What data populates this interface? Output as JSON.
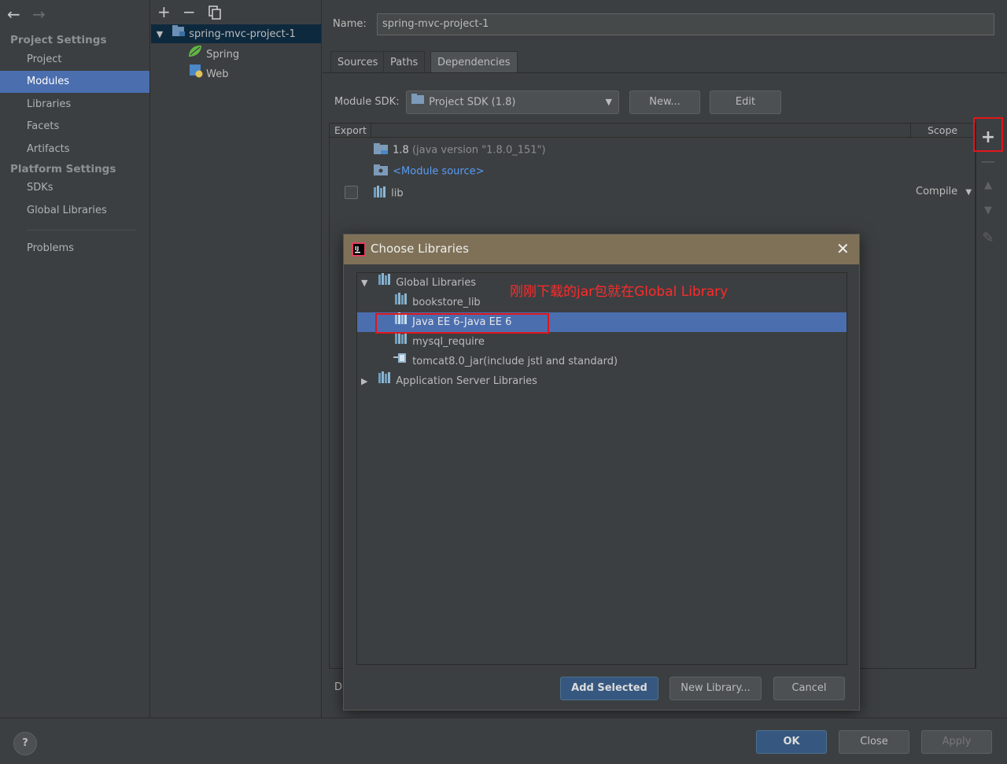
{
  "nav": {
    "back_icon": "arrow-left-icon",
    "forward_icon": "arrow-right-icon",
    "project_settings_heading": "Project Settings",
    "project_settings_items": [
      "Project",
      "Modules",
      "Libraries",
      "Facets",
      "Artifacts"
    ],
    "platform_settings_heading": "Platform Settings",
    "platform_settings_items": [
      "SDKs",
      "Global Libraries"
    ],
    "problems": "Problems",
    "selected_item": "Modules"
  },
  "module_tree": {
    "toolbar": {
      "add": "+",
      "remove": "−",
      "copy": "copy-icon"
    },
    "root": "spring-mvc-project-1",
    "children": [
      "Spring",
      "Web"
    ]
  },
  "module": {
    "name_label": "Name:",
    "name_value": "spring-mvc-project-1",
    "tabs": [
      "Sources",
      "Paths",
      "Dependencies"
    ],
    "active_tab": "Dependencies",
    "sdk_label": "Module SDK:",
    "sdk_value": "Project SDK (1.8)",
    "sdk_new_button": "New...",
    "sdk_edit_button": "Edit",
    "table": {
      "col_export": "Export",
      "col_scope": "Scope",
      "rows": [
        {
          "name": "1.8",
          "detail": "(java version \"1.8.0_151\")"
        },
        {
          "name": "<Module source>"
        },
        {
          "name": "lib",
          "scope": "Compile"
        }
      ]
    },
    "bottom_truncated_label": "D"
  },
  "dialog": {
    "title": "Choose Libraries",
    "tree": {
      "global_libraries": "Global Libraries",
      "items": [
        "bookstore_lib",
        "Java EE 6-Java EE 6",
        "mysql_require",
        "tomcat8.0_jar(include jstl and standard)"
      ],
      "selected": "Java EE 6-Java EE 6",
      "app_server_libraries": "Application Server Libraries"
    },
    "annotation": "刚刚下载的jar包就在Global Library",
    "add_selected_button": "Add Selected",
    "new_library_button": "New Library...",
    "cancel_button": "Cancel"
  },
  "footer": {
    "help": "?",
    "ok_button": "OK",
    "close_button": "Close",
    "apply_button": "Apply"
  },
  "colors": {
    "background": "#3c3f41",
    "selection": "#4b6eaf",
    "dialog_title": "#7f7157",
    "annotation_red": "#e0161c",
    "link": "#589df6"
  }
}
